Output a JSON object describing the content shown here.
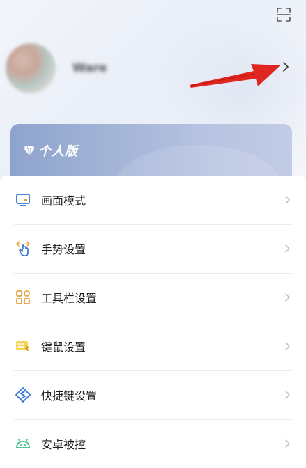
{
  "header": {
    "scan_icon": "scan-icon"
  },
  "profile": {
    "username": "Ware",
    "chevron_icon": "chevron-right-icon"
  },
  "version_card": {
    "label": "个人版",
    "icon": "diamond-icon"
  },
  "menu": {
    "items": [
      {
        "label": "画面模式",
        "icon": "monitor-icon"
      },
      {
        "label": "手势设置",
        "icon": "gesture-icon"
      },
      {
        "label": "工具栏设置",
        "icon": "grid-icon"
      },
      {
        "label": "键鼠设置",
        "icon": "keyboard-mouse-icon"
      },
      {
        "label": "快捷键设置",
        "icon": "shortcut-icon"
      },
      {
        "label": "安卓被控",
        "icon": "android-icon"
      }
    ]
  },
  "colors": {
    "accent_blue": "#2f6fd1",
    "accent_orange": "#e8a23a",
    "annotation_red": "#e0261f"
  }
}
